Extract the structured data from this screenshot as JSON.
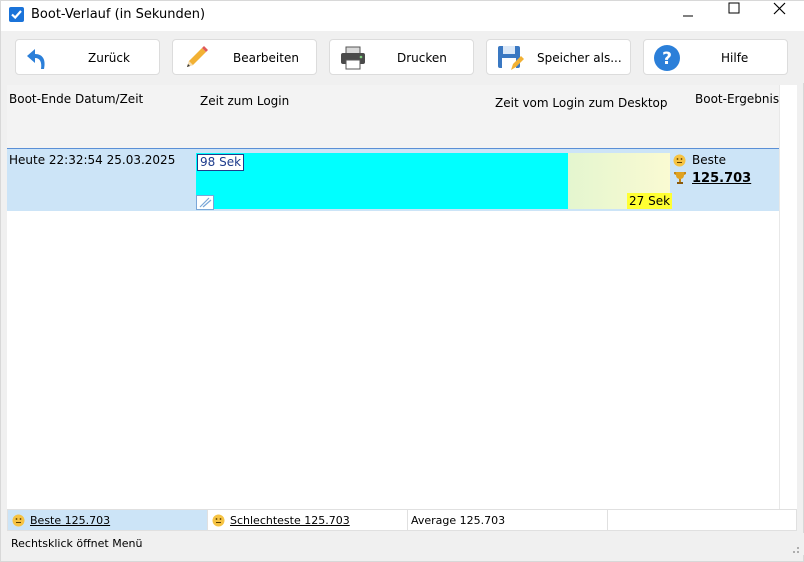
{
  "window": {
    "title": "Boot-Verlauf (in Sekunden)"
  },
  "toolbar": {
    "back_label": "Zurück",
    "edit_label": "Bearbeiten",
    "print_label": "Drucken",
    "save_label": "Speicher als...",
    "help_label": "Hilfe"
  },
  "table": {
    "headers": {
      "date": "Boot-Ende Datum/Zeit",
      "login": "Zeit zum Login",
      "desktop": "Zeit vom Login zum Desktop",
      "result": "Boot-Ergebnis"
    },
    "rows": [
      {
        "date": "Heute  22:32:54 25.03.2025",
        "login_time": "98 Sek",
        "desktop_time": "27 Sek",
        "result_label": "Beste",
        "result_value": "125.703"
      }
    ]
  },
  "footer": {
    "best": "Beste 125.703",
    "worst": "Schlechteste 125.703",
    "average": "Average 125.703"
  },
  "status": {
    "hint": "Rechtsklick öffnet Menü"
  },
  "colors": {
    "login_bar": "#00ffff",
    "desktop_bar": "#e4f6cf",
    "desktop_label_bg": "#ffff33",
    "row_selected": "#cce4f7",
    "accent": "#1a73d9"
  },
  "icons": {
    "back": "back-arrow-icon",
    "edit": "pencil-icon",
    "print": "printer-icon",
    "save": "floppy-disk-icon",
    "help": "question-mark-icon"
  }
}
